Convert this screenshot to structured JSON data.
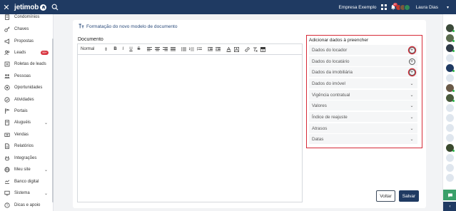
{
  "topbar": {
    "close_icon": "close-icon",
    "brand": "jetimob",
    "company": "Empresa Exemplo",
    "notification_count": "12",
    "user_name": "Laura Dias",
    "caret": "▾"
  },
  "sidebar": {
    "items": [
      {
        "label": "Condomínios",
        "icon": "building-icon"
      },
      {
        "label": "Chaves",
        "icon": "key-icon"
      },
      {
        "label": "Propostas",
        "icon": "megaphone-icon"
      },
      {
        "label": "Leads",
        "icon": "users-icon",
        "badge": "99+"
      },
      {
        "label": "Roletas de leads",
        "icon": "roulette-icon"
      },
      {
        "label": "Pessoas",
        "icon": "people-icon"
      },
      {
        "label": "Oportunidades",
        "icon": "target-icon"
      },
      {
        "label": "Atividades",
        "icon": "check-circle-icon"
      },
      {
        "label": "Portais",
        "icon": "flag-icon"
      },
      {
        "label": "Aluguéis",
        "icon": "contract-icon",
        "chevron": "⌄"
      },
      {
        "label": "Vendas",
        "icon": "sale-icon"
      },
      {
        "label": "Relatórios",
        "icon": "report-icon"
      },
      {
        "label": "Integrações",
        "icon": "integration-icon"
      },
      {
        "label": "Meu site",
        "icon": "globe-icon",
        "chevron": "⌄"
      },
      {
        "label": "Banco digital",
        "icon": "bank-icon"
      },
      {
        "label": "Sistema",
        "icon": "monitor-icon",
        "chevron": "⌄"
      },
      {
        "label": "Dicas e apoio",
        "icon": "help-icon"
      }
    ]
  },
  "main": {
    "title": "Formatação do novo modelo de documento",
    "document_label": "Documento",
    "format_select": "Normal",
    "format_arrows": "⇕"
  },
  "panel": {
    "title": "Adicionar dados à preencher",
    "items": [
      {
        "label": "Dados do locador",
        "action": "plus",
        "highlight": true
      },
      {
        "label": "Dados do locatário",
        "action": "plus",
        "highlight": false
      },
      {
        "label": "Dados da imobiliária",
        "action": "plus",
        "highlight": true
      },
      {
        "label": "Dados do imóvel",
        "action": "chevron"
      },
      {
        "label": "Vigência contratual",
        "action": "chevron"
      },
      {
        "label": "Valores",
        "action": "chevron"
      },
      {
        "label": "Índice de reajuste",
        "action": "chevron"
      },
      {
        "label": "Atrasos",
        "action": "chevron"
      },
      {
        "label": "Datas",
        "action": "chevron"
      }
    ],
    "plus_glyph": "+",
    "chevron_glyph": "⌄"
  },
  "actions": {
    "back": "Voltar",
    "save": "Salvar"
  },
  "colors": {
    "navy": "#1f3a62",
    "highlight_red": "#d62b38",
    "badge_red": "#d8343f"
  }
}
